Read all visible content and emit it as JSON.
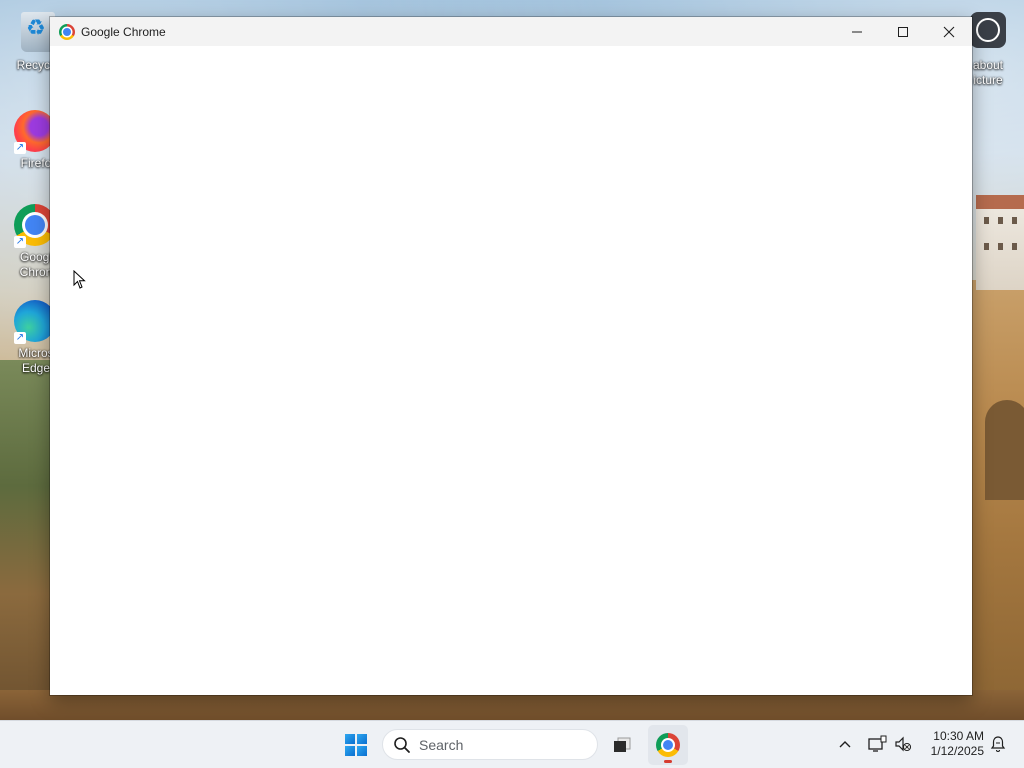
{
  "window": {
    "title": "Google Chrome",
    "minimize_icon": "minimize-icon",
    "maximize_icon": "maximize-icon",
    "close_icon": "close-icon"
  },
  "desktop_icons": [
    {
      "label": "Recycle",
      "icon": "recycle-bin-icon"
    },
    {
      "label": "Firefo",
      "icon": "firefox-icon"
    },
    {
      "label": "Googl",
      "label_line2": "Chron",
      "icon": "chrome-icon"
    },
    {
      "label": "Micros",
      "label_line2": "Edge",
      "icon": "edge-icon"
    },
    {
      "label": "about",
      "label_line2": "icture",
      "icon": "about-picture-icon"
    }
  ],
  "taskbar": {
    "search_placeholder": "Search",
    "clock_time": "10:30 AM",
    "clock_date": "1/12/2025",
    "running_app": "Google Chrome",
    "accent_color": "#0a6fd0"
  }
}
